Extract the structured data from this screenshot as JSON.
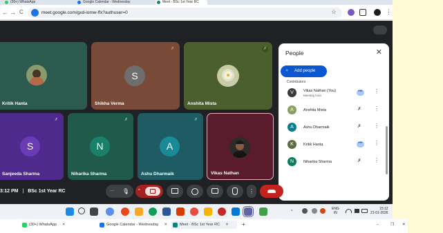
{
  "browser": {
    "tabs_top": [
      {
        "label": "(30+) WhatsApp",
        "color": "#25d366"
      },
      {
        "label": "Google Calendar - Wednesday",
        "color": "#1a73e8"
      },
      {
        "label": "Meet - BSc 1st Year RC",
        "color": "#00897b"
      }
    ],
    "nav_icons": [
      "back-arrow",
      "forward-arrow",
      "reload"
    ],
    "url": "meet.google.com/gxd-iomw-ffx?authuser=0",
    "nav_glyphs": {
      "back": "←",
      "forward": "→",
      "reload": "C",
      "star": "☆"
    }
  },
  "tiles": [
    {
      "name": "Kritik Hanta",
      "bg": "#2d5a4e",
      "type": "photo",
      "photo_color": "#5c6b44"
    },
    {
      "name": "Shikha Verma",
      "bg": "#7a4a38",
      "type": "letter",
      "letter": "S",
      "avatar_bg": "#6e6e6e",
      "muted": true
    },
    {
      "name": "Anshita Mista",
      "bg": "#4a5e2e",
      "type": "photo",
      "photo_color": "#dde0c8",
      "muted": true
    },
    {
      "name": "Sanjeeda Sharma",
      "bg": "#4d2a8c",
      "type": "letter",
      "letter": "S",
      "avatar_bg": "#6a3bb5",
      "muted": true
    },
    {
      "name": "Niharika Sharma",
      "bg": "#1f5a4a",
      "type": "letter",
      "letter": "N",
      "avatar_bg": "#19806a",
      "muted": true
    },
    {
      "name": "Ashu Dharmaik",
      "bg": "#1e5b62",
      "type": "letter",
      "letter": "A",
      "avatar_bg": "#1a8a98",
      "muted": true
    },
    {
      "name": "Vikas Nathan",
      "bg": "#5a1c2c",
      "type": "photo",
      "photo_color": "#2a2a2a",
      "active": true
    }
  ],
  "people_panel": {
    "title": "People",
    "add_people": "Add people",
    "section": "Contributors",
    "participants": [
      {
        "name": "Vikas Nathan (You)",
        "sub": "Meeting host",
        "avatar": "V",
        "avatar_bg": "#3a3a3a",
        "state": "speaking"
      },
      {
        "name": "Anshita Mista",
        "sub": "",
        "avatar": "A",
        "avatar_bg": "#8aa060",
        "state": "muted"
      },
      {
        "name": "Ashu Dharmaik",
        "sub": "",
        "avatar": "A",
        "avatar_bg": "#0b7d8a",
        "state": "muted"
      },
      {
        "name": "Kritik Hanta",
        "sub": "",
        "avatar": "K",
        "avatar_bg": "#5c6b44",
        "state": "speaking"
      },
      {
        "name": "Niharika Sharma",
        "sub": "",
        "avatar": "N",
        "avatar_bg": "#0b7d5e",
        "state": "muted"
      }
    ]
  },
  "meeting_info": {
    "time": "3:12 PM",
    "separator": "|",
    "title": "BSc 1st Year RC"
  },
  "controls": {
    "more_dots": "···",
    "mic": "mic-icon",
    "camera": "camera-off-icon",
    "present": "present-icon",
    "emoji": "emoji-icon",
    "captions": "captions-icon",
    "hand": "raise-hand-icon",
    "more": "more-vert-icon",
    "end_call": "end-call-icon"
  },
  "right_controls": [
    "info-icon",
    "chat-icon",
    "activities-icon",
    "host-controls-icon"
  ],
  "taskbar": {
    "lang": "ENG",
    "region": "IN",
    "time": "15:12",
    "date": "21-01-2026"
  },
  "bottom_tabs": [
    {
      "label": "(30+) WhatsApp",
      "color": "#25d366"
    },
    {
      "label": "Google Calendar - Wednesday",
      "color": "#1a73e8"
    },
    {
      "label": "Meet - BSc 1st Year RC",
      "color": "#00897b"
    }
  ],
  "icon_glyphs": {
    "close": "✕",
    "add_person": "⁺",
    "muted_mic": "✗",
    "more_vert": "⋮",
    "dots": "•••",
    "mic": "🎙",
    "info": "ⓘ",
    "chat": "▤",
    "grid": "⊞",
    "lock": "⚿",
    "plus": "+",
    "minimize": "–",
    "restore": "❐"
  }
}
